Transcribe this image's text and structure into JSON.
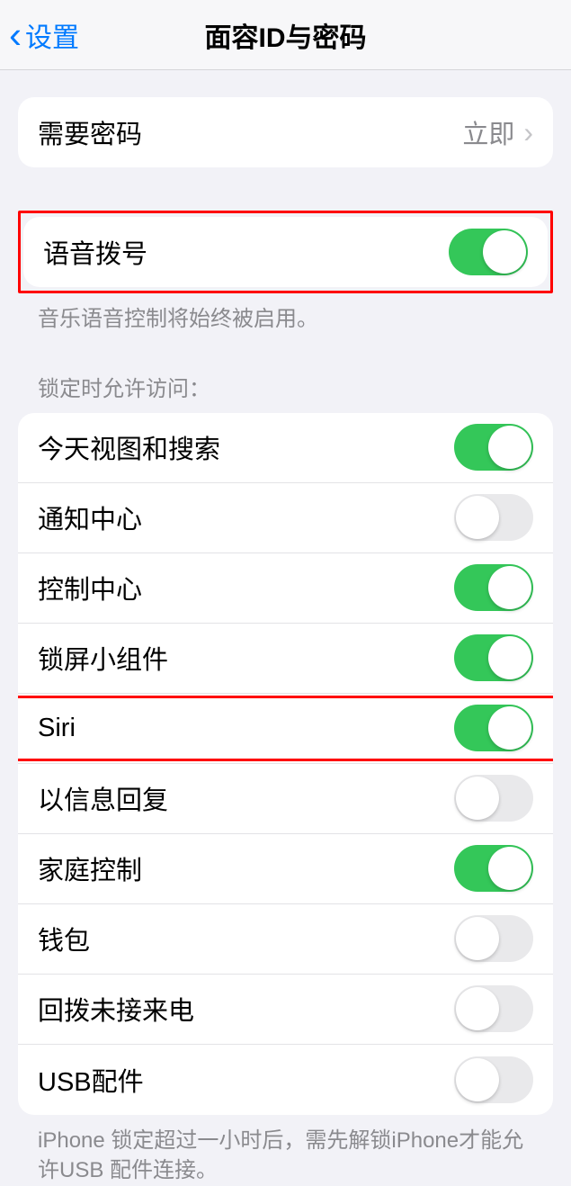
{
  "header": {
    "back_label": "设置",
    "title": "面容ID与密码"
  },
  "require_passcode": {
    "label": "需要密码",
    "value": "立即"
  },
  "voice_dial": {
    "label": "语音拨号",
    "footer": "音乐语音控制将始终被启用。",
    "on": true
  },
  "lock_access": {
    "header": "锁定时允许访问：",
    "items": [
      {
        "label": "今天视图和搜索",
        "on": true
      },
      {
        "label": "通知中心",
        "on": false
      },
      {
        "label": "控制中心",
        "on": true
      },
      {
        "label": "锁屏小组件",
        "on": true
      },
      {
        "label": "Siri",
        "on": true,
        "highlighted": true
      },
      {
        "label": "以信息回复",
        "on": false
      },
      {
        "label": "家庭控制",
        "on": true
      },
      {
        "label": "钱包",
        "on": false
      },
      {
        "label": "回拨未接来电",
        "on": false
      },
      {
        "label": "USB配件",
        "on": false
      }
    ],
    "footer": "iPhone 锁定超过一小时后，需先解锁iPhone才能允许USB 配件连接。"
  }
}
